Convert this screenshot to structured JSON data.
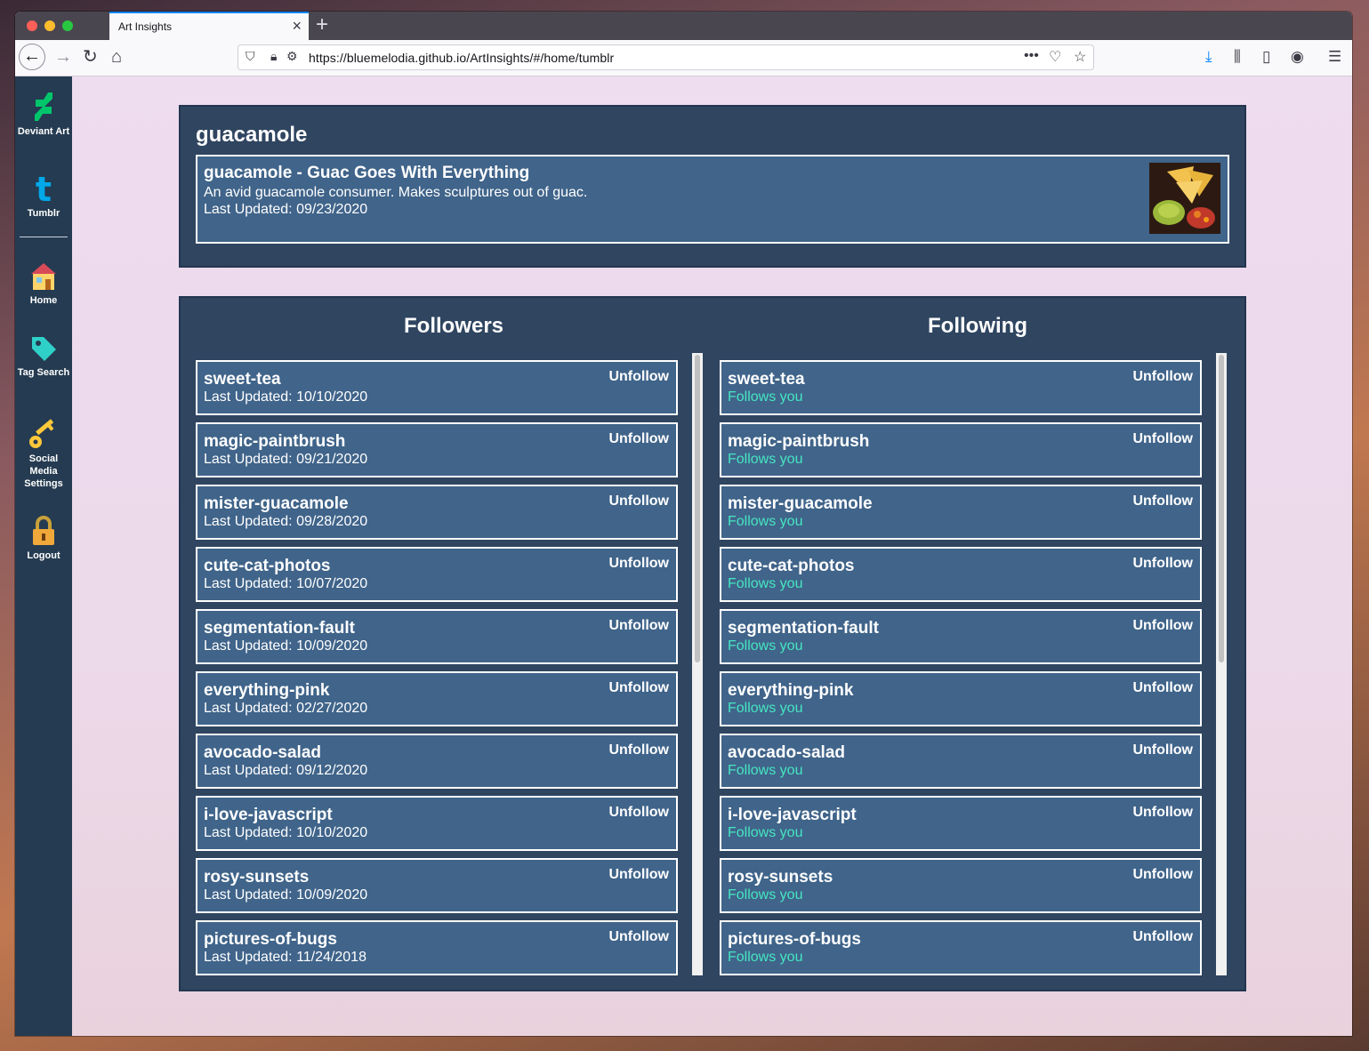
{
  "browser": {
    "tab_title": "Art Insights",
    "url": "https://bluemelodia.github.io/ArtInsights/#/home/tumblr"
  },
  "sidebar": {
    "items": [
      {
        "label": "Deviant Art",
        "icon": "deviantart-icon"
      },
      {
        "label": "Tumblr",
        "icon": "tumblr-icon"
      },
      {
        "label": "Home",
        "icon": "home-icon"
      },
      {
        "label": "Tag Search",
        "icon": "tag-icon"
      },
      {
        "label": "Social Media Settings",
        "icon": "key-icon"
      },
      {
        "label": "Logout",
        "icon": "lock-icon"
      }
    ]
  },
  "profile": {
    "heading": "guacamole",
    "title": "guacamole - Guac Goes With Everything",
    "description": "An avid guacamole consumer. Makes sculptures out of guac.",
    "last_updated": "Last Updated: 09/23/2020"
  },
  "followers": {
    "heading": "Followers",
    "items": [
      {
        "name": "sweet-tea",
        "sub": "Last Updated: 10/10/2020",
        "action": "Unfollow"
      },
      {
        "name": "magic-paintbrush",
        "sub": "Last Updated: 09/21/2020",
        "action": "Unfollow"
      },
      {
        "name": "mister-guacamole",
        "sub": "Last Updated: 09/28/2020",
        "action": "Unfollow"
      },
      {
        "name": "cute-cat-photos",
        "sub": "Last Updated: 10/07/2020",
        "action": "Unfollow"
      },
      {
        "name": "segmentation-fault",
        "sub": "Last Updated: 10/09/2020",
        "action": "Unfollow"
      },
      {
        "name": "everything-pink",
        "sub": "Last Updated: 02/27/2020",
        "action": "Unfollow"
      },
      {
        "name": "avocado-salad",
        "sub": "Last Updated: 09/12/2020",
        "action": "Unfollow"
      },
      {
        "name": "i-love-javascript",
        "sub": "Last Updated: 10/10/2020",
        "action": "Unfollow"
      },
      {
        "name": "rosy-sunsets",
        "sub": "Last Updated: 10/09/2020",
        "action": "Unfollow"
      },
      {
        "name": "pictures-of-bugs",
        "sub": "Last Updated: 11/24/2018",
        "action": "Unfollow"
      }
    ]
  },
  "following": {
    "heading": "Following",
    "items": [
      {
        "name": "sweet-tea",
        "sub": "Follows you",
        "action": "Unfollow"
      },
      {
        "name": "magic-paintbrush",
        "sub": "Follows you",
        "action": "Unfollow"
      },
      {
        "name": "mister-guacamole",
        "sub": "Follows you",
        "action": "Unfollow"
      },
      {
        "name": "cute-cat-photos",
        "sub": "Follows you",
        "action": "Unfollow"
      },
      {
        "name": "segmentation-fault",
        "sub": "Follows you",
        "action": "Unfollow"
      },
      {
        "name": "everything-pink",
        "sub": "Follows you",
        "action": "Unfollow"
      },
      {
        "name": "avocado-salad",
        "sub": "Follows you",
        "action": "Unfollow"
      },
      {
        "name": "i-love-javascript",
        "sub": "Follows you",
        "action": "Unfollow"
      },
      {
        "name": "rosy-sunsets",
        "sub": "Follows you",
        "action": "Unfollow"
      },
      {
        "name": "pictures-of-bugs",
        "sub": "Follows you",
        "action": "Unfollow"
      }
    ]
  },
  "colors": {
    "panel": "#2f4560",
    "card": "#40648a",
    "sidebar": "#253b51",
    "follows_you": "#46e6c1"
  }
}
